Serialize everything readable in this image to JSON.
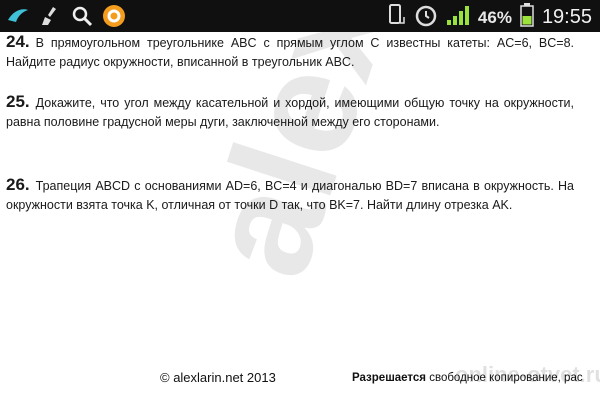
{
  "status_bar": {
    "icons_left": [
      "bird-app-icon",
      "broom-icon",
      "search-icon",
      "browser-icon"
    ],
    "icons_right": [
      "phone-orientation-icon",
      "alarm-icon",
      "signal-icon"
    ],
    "battery_percent": "46%",
    "time": "19:55"
  },
  "problems": [
    {
      "number": "24.",
      "text": "В прямоугольном треугольнике ABC с прямым углом C известны катеты: AC=6, BC=8. Найдите радиус окружности, вписанной в треугольник ABC."
    },
    {
      "number": "25.",
      "text": "Докажите, что угол между касательной и хордой, имеющими общую точку на окружности, равна половине градусной меры дуги, заключенной между его сторонами."
    },
    {
      "number": "26.",
      "text": "Трапеция ABCD с основаниями AD=6, BC=4 и диагональю BD=7 вписана в окружность. На окружности взята точка K, отличная от точки D так, что BK=7. Найти длину отрезка AK."
    }
  ],
  "watermark": "alexlarin",
  "footer": {
    "copyright": "© alexlarin.net 2013",
    "permission_bold": "Разрешается",
    "permission_rest": " свободное копирование, рас"
  },
  "site_watermark": "online-otvet.ru"
}
